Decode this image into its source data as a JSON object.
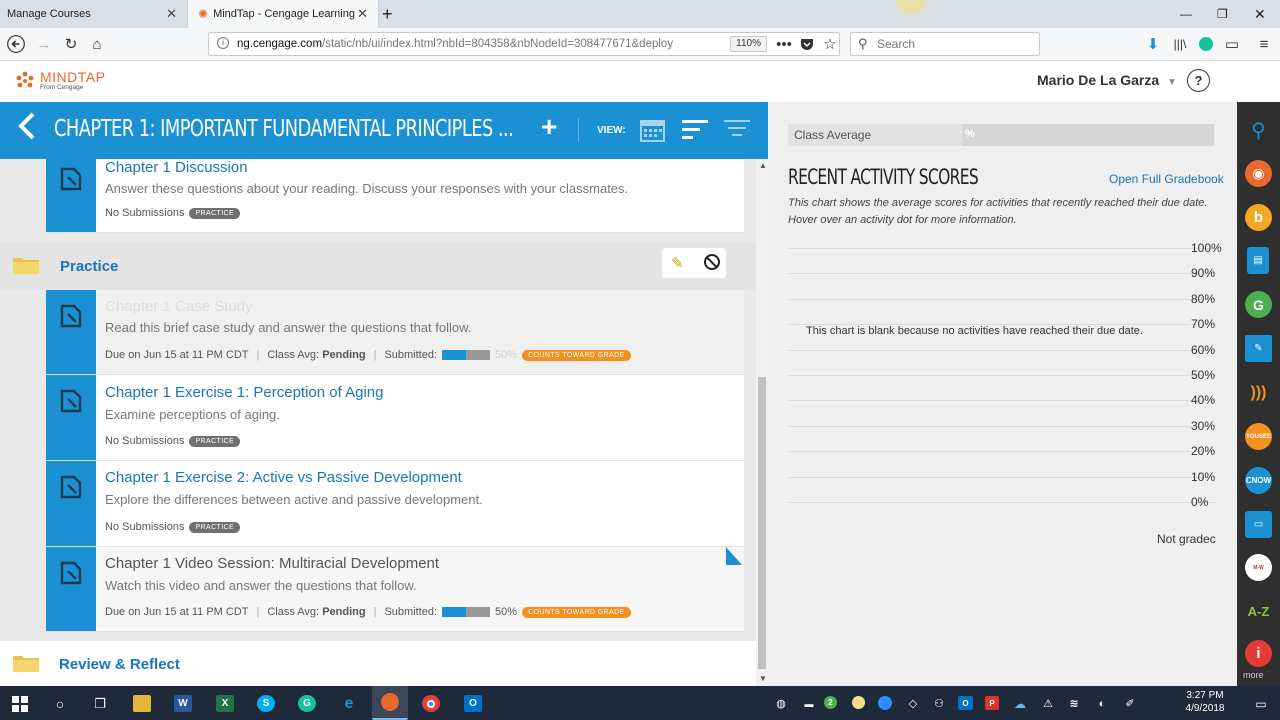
{
  "browser": {
    "tabs": [
      {
        "label": "Manage Courses"
      },
      {
        "label": "MindTap - Cengage Learning"
      }
    ],
    "url_domain": "ng.cengage.com",
    "url_path": "/static/nb/ui/index.html?nbId=804358&nbNodeId=308477671&deploy",
    "zoom": "110%",
    "search_placeholder": "Search"
  },
  "header": {
    "logo_text": "MINDTAP",
    "logo_sub": "From Cengage",
    "user_name": "Mario De La Garza",
    "help_label": "?"
  },
  "chapter": {
    "title": "CHAPTER 1: IMPORTANT FUNDAMENTAL PRINCIPLES ...",
    "view_label": "VIEW:"
  },
  "activities_top": [
    {
      "title": "Chapter 1 Discussion",
      "description": "Answer these questions about your reading. Discuss your responses with your classmates.",
      "status": "No Submissions",
      "tag": "PRACTICE"
    }
  ],
  "folders": [
    {
      "label": "Practice"
    },
    {
      "label": "Review & Reflect"
    }
  ],
  "practice_items": [
    {
      "title": "Chapter 1 Case Study",
      "description": "Read this brief case study and answer the questions that follow.",
      "due": "Due on Jun 15 at 11 PM CDT",
      "class_avg_label": "Class Avg:",
      "class_avg_value": "Pending",
      "submitted_label": "Submitted:",
      "submitted_pct": "50%",
      "tag": "COUNTS TOWARD GRADE"
    },
    {
      "title": "Chapter 1 Exercise 1: Perception of Aging",
      "description": "Examine perceptions of aging.",
      "status": "No Submissions",
      "tag": "PRACTICE"
    },
    {
      "title": "Chapter 1 Exercise 2: Active vs Passive Development",
      "description": "Explore the differences between active and passive development.",
      "status": "No Submissions",
      "tag": "PRACTICE"
    },
    {
      "title": "Chapter 1 Video Session: Multiracial Development",
      "description": "Watch this video and answer the questions that follow.",
      "due": "Due on Jun 15 at 11 PM CDT",
      "class_avg_label": "Class Avg:",
      "class_avg_value": "Pending",
      "submitted_label": "Submitted:",
      "submitted_pct": "50%",
      "tag": "COUNTS TOWARD GRADE"
    }
  ],
  "gradebook": {
    "class_average_label": "Class Average",
    "class_average_value": "%",
    "recent_title": "RECENT ACTIVITY SCORES",
    "open_link": "Open Full Gradebook",
    "description_line1": "This chart shows the average scores for activities that recently reached their due date.",
    "description_line2": "Hover over an activity dot for more information.",
    "blank_message": "This chart is blank because no activities have reached their due date.",
    "y_ticks": [
      "100%",
      "90%",
      "80%",
      "70%",
      "60%",
      "50%",
      "40%",
      "30%",
      "20%",
      "10%",
      "0%"
    ],
    "not_graded": "Not gradec"
  },
  "app_rail": {
    "more_label": "more",
    "icons": [
      "search-icon",
      "rss-icon",
      "bookshelf-icon",
      "book-icon",
      "google-icon",
      "highlight-icon",
      "readspeaker-icon",
      "youseeu-icon",
      "cnow-icon",
      "flashcards-icon",
      "merriam-webster-icon",
      "a-z-icon",
      "info-icon"
    ],
    "colors": {
      "blue": "#1b91d3",
      "orange": "#f29020",
      "rail": "#2f2f2f"
    }
  },
  "taskbar": {
    "time": "3:27 PM",
    "date": "4/9/2018"
  }
}
